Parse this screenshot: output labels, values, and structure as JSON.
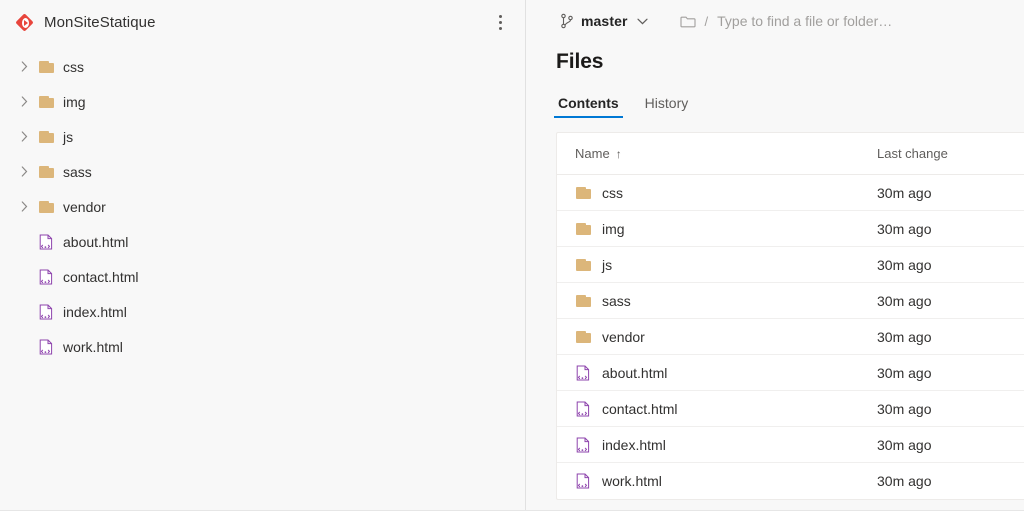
{
  "sidebar": {
    "repo_name": "MonSiteStatique",
    "repo_icon": "azure-repos-icon",
    "menu_icon": "more-vertical-icon",
    "tree": [
      {
        "label": "css",
        "type": "folder",
        "icon": "folder-icon",
        "expandable": true,
        "chevron": "chevron-right-icon"
      },
      {
        "label": "img",
        "type": "folder",
        "icon": "folder-icon",
        "expandable": true,
        "chevron": "chevron-right-icon"
      },
      {
        "label": "js",
        "type": "folder",
        "icon": "folder-icon",
        "expandable": true,
        "chevron": "chevron-right-icon"
      },
      {
        "label": "sass",
        "type": "folder",
        "icon": "folder-icon",
        "expandable": true,
        "chevron": "chevron-right-icon"
      },
      {
        "label": "vendor",
        "type": "folder",
        "icon": "folder-icon",
        "expandable": true,
        "chevron": "chevron-right-icon"
      },
      {
        "label": "about.html",
        "type": "file",
        "icon": "html-file-icon",
        "expandable": false,
        "chevron": ""
      },
      {
        "label": "contact.html",
        "type": "file",
        "icon": "html-file-icon",
        "expandable": false,
        "chevron": ""
      },
      {
        "label": "index.html",
        "type": "file",
        "icon": "html-file-icon",
        "expandable": false,
        "chevron": ""
      },
      {
        "label": "work.html",
        "type": "file",
        "icon": "html-file-icon",
        "expandable": false,
        "chevron": ""
      }
    ]
  },
  "breadcrumb": {
    "branch_icon": "git-branch-icon",
    "branch_name": "master",
    "branch_chevron": "chevron-down-icon",
    "folder_icon": "folder-outline-icon",
    "separator": "/",
    "search_placeholder": "Type to find a file or folder…"
  },
  "page": {
    "title": "Files"
  },
  "tabs": [
    {
      "label": "Contents",
      "active": true
    },
    {
      "label": "History",
      "active": false
    }
  ],
  "table": {
    "columns": [
      {
        "label": "Name",
        "sort_icon": "↑"
      },
      {
        "label": "Last change",
        "sort_icon": ""
      }
    ],
    "rows": [
      {
        "name": "css",
        "icon": "folder-icon",
        "last_change": "30m ago"
      },
      {
        "name": "img",
        "icon": "folder-icon",
        "last_change": "30m ago"
      },
      {
        "name": "js",
        "icon": "folder-icon",
        "last_change": "30m ago"
      },
      {
        "name": "sass",
        "icon": "folder-icon",
        "last_change": "30m ago"
      },
      {
        "name": "vendor",
        "icon": "folder-icon",
        "last_change": "30m ago"
      },
      {
        "name": "about.html",
        "icon": "html-file-icon",
        "last_change": "30m ago"
      },
      {
        "name": "contact.html",
        "icon": "html-file-icon",
        "last_change": "30m ago"
      },
      {
        "name": "index.html",
        "icon": "html-file-icon",
        "last_change": "30m ago"
      },
      {
        "name": "work.html",
        "icon": "html-file-icon",
        "last_change": "30m ago"
      }
    ]
  },
  "colors": {
    "accent": "#0078d4",
    "repo_icon": "#e8453c",
    "folder": "#dcb67a",
    "html_icon": "#8e44ad",
    "page_bg": "#f8f8f8",
    "card_bg": "#ffffff"
  }
}
